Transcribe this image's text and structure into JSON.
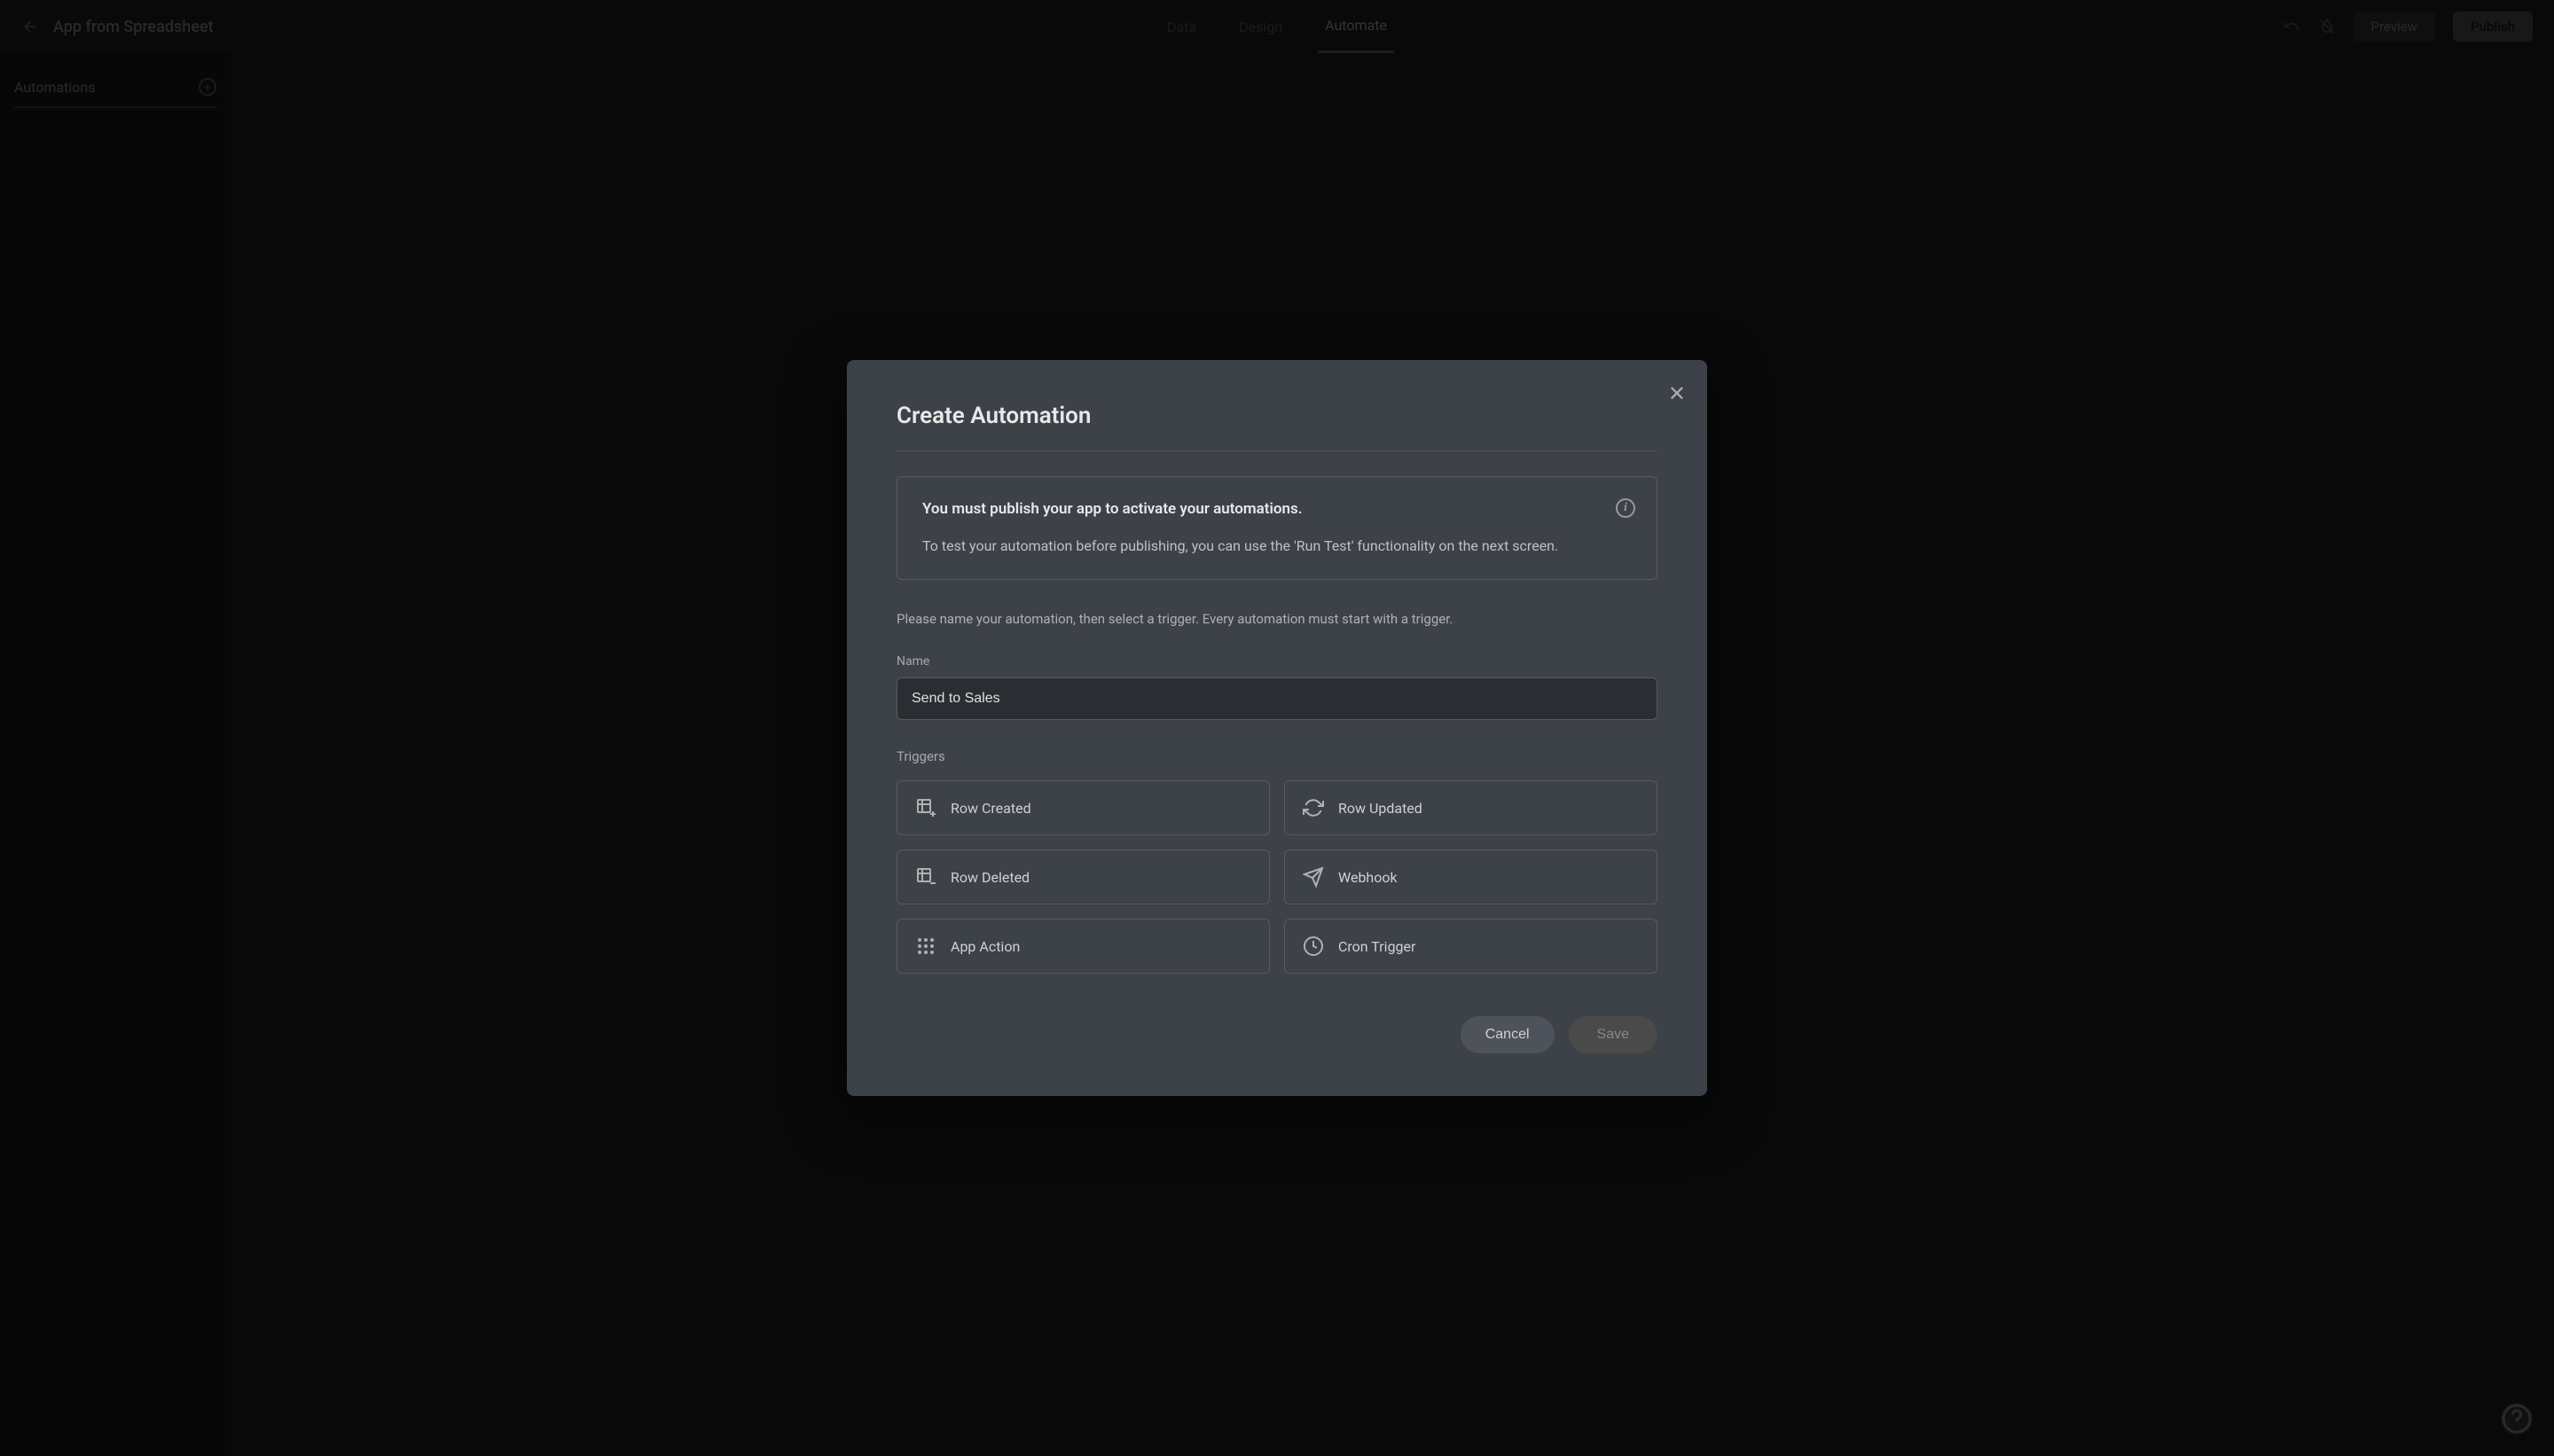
{
  "header": {
    "app_title": "App from Spreadsheet",
    "tabs": {
      "data": "Data",
      "design": "Design",
      "automate": "Automate"
    },
    "preview_label": "Preview",
    "publish_label": "Publish"
  },
  "sidebar": {
    "title": "Automations"
  },
  "modal": {
    "title": "Create Automation",
    "notice_strong": "You must publish your app to activate your automations.",
    "notice_text": "To test your automation before publishing, you can use the 'Run Test' functionality on the next screen.",
    "instruction": "Please name your automation, then select a trigger. Every automation must start with a trigger.",
    "name_label": "Name",
    "name_value": "Send to Sales",
    "triggers_label": "Triggers",
    "triggers": {
      "row_created": "Row Created",
      "row_updated": "Row Updated",
      "row_deleted": "Row Deleted",
      "webhook": "Webhook",
      "app_action": "App Action",
      "cron": "Cron Trigger"
    },
    "cancel_label": "Cancel",
    "save_label": "Save"
  }
}
